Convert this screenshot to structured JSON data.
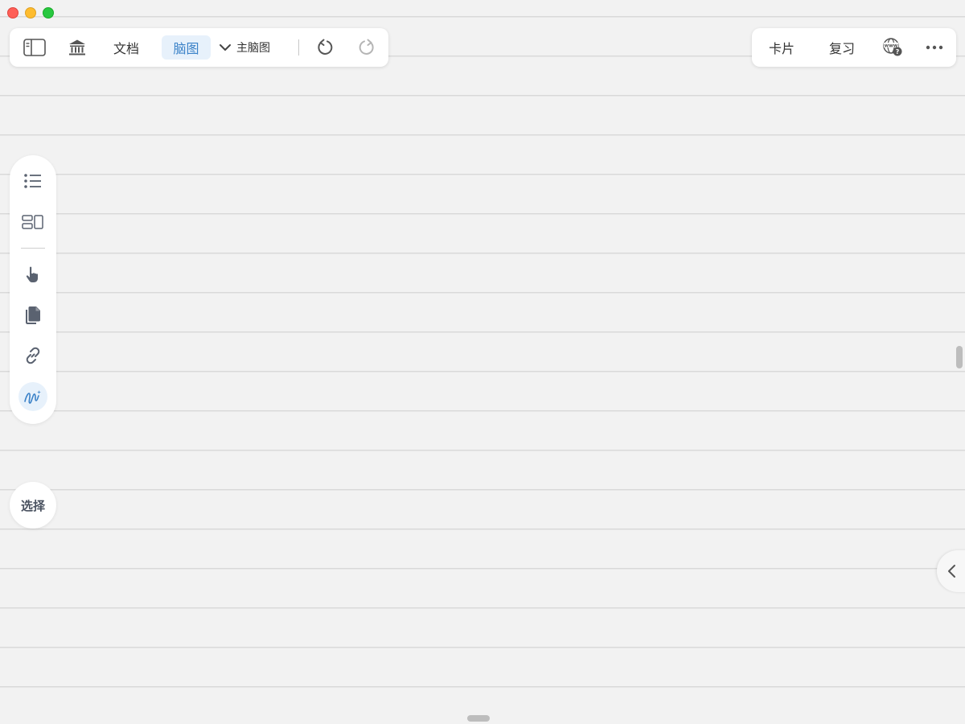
{
  "toolbar_left": {
    "doc_label": "文档",
    "mindmap_label": "脑图",
    "map_select_value": "主脑图"
  },
  "toolbar_right": {
    "cards_label": "卡片",
    "review_label": "复习"
  },
  "side_palette": {
    "icons": [
      "list-icon",
      "layout-icon",
      "pointer-hand-icon",
      "documents-icon",
      "link-icon",
      "freehand-draw-icon"
    ],
    "active": "freehand-draw-icon"
  },
  "select_button": {
    "label": "选择"
  },
  "colors": {
    "accent": "#3b82c8",
    "accent_bg": "#e7f1fb",
    "canvas_bg": "#f2f2f2",
    "ruled_line": "#d9d9d9"
  }
}
